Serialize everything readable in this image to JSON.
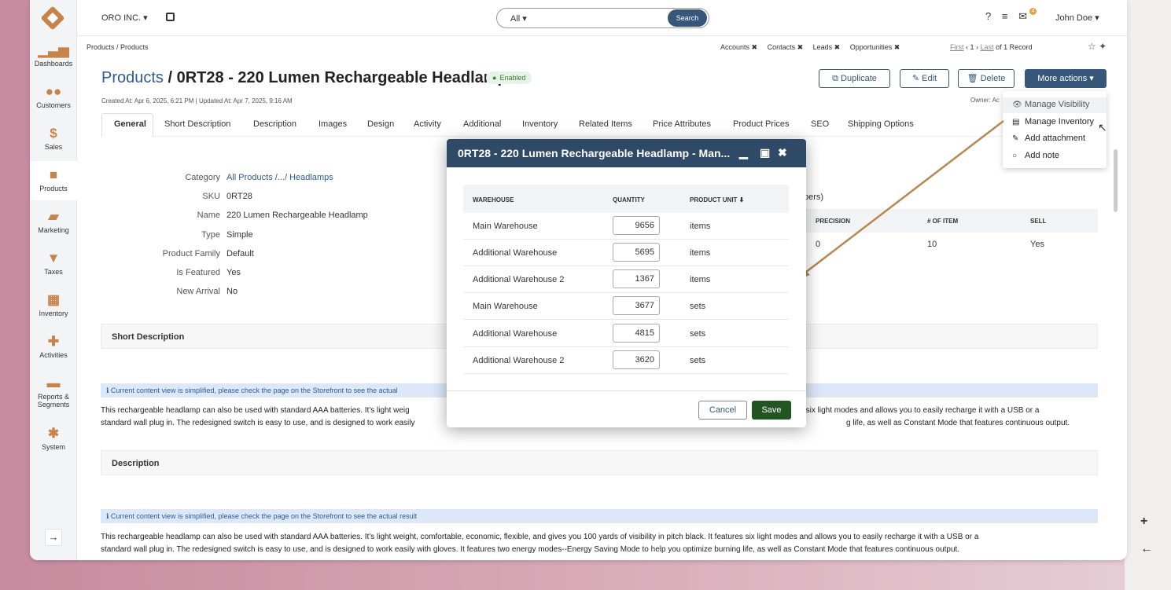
{
  "topbar": {
    "org": "ORO INC. ▾",
    "search_scope": "All ▾",
    "search_button": "Search",
    "notification_count": "4",
    "user": "John Doe ▾"
  },
  "sidebar": {
    "items": [
      {
        "label": "Dashboards",
        "icon": "bar-chart-icon"
      },
      {
        "label": "Customers",
        "icon": "users-icon"
      },
      {
        "label": "Sales",
        "icon": "dollar-icon"
      },
      {
        "label": "Products",
        "icon": "briefcase-icon"
      },
      {
        "label": "Marketing",
        "icon": "book-icon"
      },
      {
        "label": "Taxes",
        "icon": "filter-icon"
      },
      {
        "label": "Inventory",
        "icon": "building-icon"
      },
      {
        "label": "Activities",
        "icon": "puzzle-icon"
      },
      {
        "label": "Reports & Segments",
        "icon": "folder-icon"
      },
      {
        "label": "System",
        "icon": "gear-icon"
      }
    ]
  },
  "breadcrumb": "Products / Products",
  "pins": [
    "Accounts ✖",
    "Contacts ✖",
    "Leads ✖",
    "Opportunities ✖"
  ],
  "pager": {
    "first": "First",
    "page": "1",
    "last": "Last",
    "of": "of 1 Record"
  },
  "header": {
    "section": "Products",
    "separator": " / ",
    "title": "0RT28 - 220 Lumen Rechargeable Headlamp",
    "status": "Enabled",
    "created": "Created At: Apr 6, 2025, 6:21 PM",
    "updated": "Updated At: Apr 7, 2025, 9:16 AM",
    "owner": "Owner: Ac",
    "buttons": {
      "duplicate": "Duplicate",
      "edit": "Edit",
      "delete": "Delete",
      "more": "More actions ▾"
    }
  },
  "tabs": [
    "General",
    "Short Description",
    "Description",
    "Images",
    "Design",
    "Activity",
    "Additional",
    "Inventory",
    "Related Items",
    "Price Attributes",
    "Product Prices",
    "SEO",
    "Shipping Options"
  ],
  "fields": [
    {
      "label": "Category",
      "value": "All Products /.../ Headlamps"
    },
    {
      "label": "SKU",
      "value": "0RT28"
    },
    {
      "label": "Name",
      "value": "220 Lumen Rechargeable Headlamp"
    },
    {
      "label": "Type",
      "value": "Simple"
    },
    {
      "label": "Product Family",
      "value": "Default"
    },
    {
      "label": "Is Featured",
      "value": "Yes"
    },
    {
      "label": "New Arrival",
      "value": "No"
    }
  ],
  "unit_table": {
    "caption_tail": "bers)",
    "headers": [
      "PRECISION",
      "# OF ITEM",
      "SELL"
    ],
    "row": [
      "0",
      "10",
      "Yes"
    ]
  },
  "sections": {
    "short_description": "Short Description",
    "description": "Description",
    "info_short": "Current content view is simplified, please check the page on the Storefront to see the actual",
    "info_full": "Current content view is simplified, please check the page on the Storefront to see the actual result",
    "para1_line1_left": "This rechargeable headlamp can also be used with standard AAA batteries. It's light weig",
    "para1_line1_right": "res six light modes and allows you to easily recharge it with a USB or a",
    "para1_line2_left": "standard wall plug in. The redesigned switch is easy to use, and is designed to work easily",
    "para1_line2_right": "g life, as well as Constant Mode that features continuous output.",
    "para2_line1": "This rechargeable headlamp can also be used with standard AAA batteries. It's light weight, comfortable, economic, flexible, and gives you 100 yards of visibility in pitch black. It features six light modes and allows you to easily recharge it with a USB or a",
    "para2_line2": "standard wall plug in. The redesigned switch is easy to use, and is designed to work easily with gloves. It features two energy modes--Energy Saving Mode to help you optimize burning life, as well as Constant Mode that features continuous output."
  },
  "menu": [
    "Manage Visibility",
    "Manage Inventory",
    "Add attachment",
    "Add note"
  ],
  "modal": {
    "title": "0RT28 - 220 Lumen Rechargeable Headlamp - Man...",
    "headers": [
      "WAREHOUSE",
      "QUANTITY",
      "PRODUCT UNIT ⬇"
    ],
    "rows": [
      {
        "warehouse": "Main Warehouse",
        "quantity": "9656",
        "unit": "items"
      },
      {
        "warehouse": "Additional Warehouse",
        "quantity": "5695",
        "unit": "items"
      },
      {
        "warehouse": "Additional Warehouse 2",
        "quantity": "1367",
        "unit": "items"
      },
      {
        "warehouse": "Main Warehouse",
        "quantity": "3677",
        "unit": "sets"
      },
      {
        "warehouse": "Additional Warehouse",
        "quantity": "4815",
        "unit": "sets"
      },
      {
        "warehouse": "Additional Warehouse 2",
        "quantity": "3620",
        "unit": "sets"
      }
    ],
    "cancel": "Cancel",
    "save": "Save"
  },
  "colors": {
    "accent": "#c6834a",
    "primary": "#36577a",
    "modal_header": "#2e4a66",
    "save": "#225522"
  }
}
